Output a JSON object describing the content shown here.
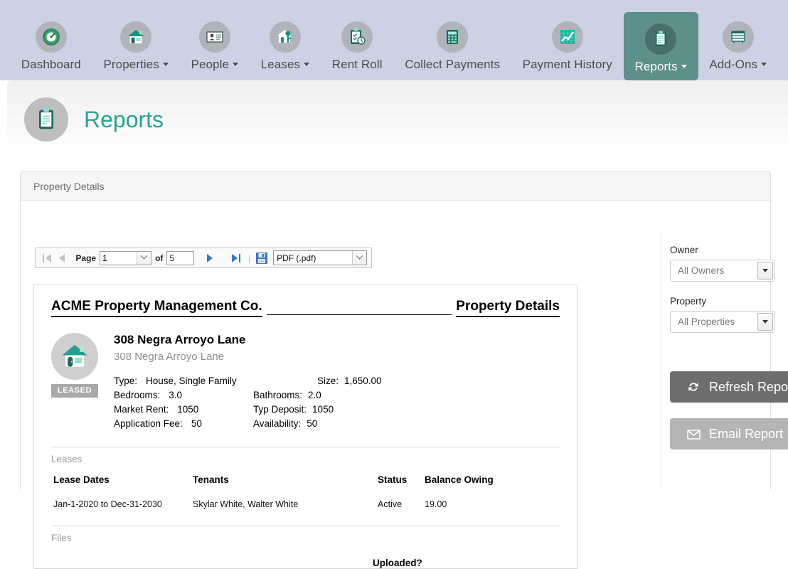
{
  "nav": {
    "items": [
      {
        "label": "Dashboard",
        "icon": "gauge-icon",
        "has_caret": false,
        "active": false
      },
      {
        "label": "Properties",
        "icon": "house-icon",
        "has_caret": true,
        "active": false
      },
      {
        "label": "People",
        "icon": "id-card-icon",
        "has_caret": true,
        "active": false
      },
      {
        "label": "Leases",
        "icon": "house-key-icon",
        "has_caret": true,
        "active": false
      },
      {
        "label": "Rent Roll",
        "icon": "clipboard-clock-icon",
        "has_caret": false,
        "active": false
      },
      {
        "label": "Collect Payments",
        "icon": "calculator-icon",
        "has_caret": false,
        "active": false
      },
      {
        "label": "Payment History",
        "icon": "line-chart-icon",
        "has_caret": false,
        "active": false
      },
      {
        "label": "Reports",
        "icon": "clipboard-icon",
        "has_caret": true,
        "active": true
      },
      {
        "label": "Add-Ons",
        "icon": "drawers-icon",
        "has_caret": true,
        "active": false
      }
    ]
  },
  "page": {
    "title": "Reports",
    "icon": "clipboard-icon"
  },
  "panel": {
    "title": "Property Details"
  },
  "viewer_toolbar": {
    "first_page_label": "first-page",
    "prev_page_label": "previous-page",
    "page_label": "Page",
    "page_value": "1",
    "of_label": "of",
    "total_pages": "5",
    "next_page_label": "next-page",
    "last_page_label": "last-page",
    "save_label": "save",
    "export_format": "PDF (.pdf)"
  },
  "report": {
    "company": "ACME Property Management Co.",
    "report_name": "Property Details",
    "property": {
      "name": "308 Negra Arroyo Lane",
      "address": "308 Negra Arroyo Lane",
      "badge": "LEASED",
      "fields": [
        {
          "k1": "Type:",
          "v1": "House, Single Family",
          "k2": "Size:",
          "v2": "1,650.00"
        },
        {
          "k1": "Bedrooms:",
          "v1": "3.0",
          "k2": "Bathrooms:",
          "v2": "2.0"
        },
        {
          "k1": "Market Rent:",
          "v1": "1050",
          "k2": "Typ Deposit:",
          "v2": "1050"
        },
        {
          "k1": "Application Fee:",
          "v1": "50",
          "k2": "Availability:",
          "v2": "50"
        }
      ]
    },
    "leases": {
      "section_label": "Leases",
      "headers": [
        "Lease Dates",
        "Tenants",
        "Status",
        "Balance Owing"
      ],
      "rows": [
        {
          "dates": "Jan-1-2020 to Dec-31-2030",
          "tenants": "Skylar White, Walter White",
          "status": "Active",
          "balance": "19.00"
        }
      ]
    },
    "files": {
      "section_label": "Files",
      "header_partial": "Uploaded?"
    }
  },
  "sidebar": {
    "owner_label": "Owner",
    "owner_value": "All Owners",
    "property_label": "Property",
    "property_value": "All Properties",
    "refresh_label": "Refresh Report",
    "email_label": "Email Report"
  },
  "colors": {
    "nav_background": "#ccd2e3",
    "accent_teal": "#2aa393",
    "active_tab": "#5d9089",
    "icon_circle": "#b0b3b8",
    "refresh_button": "#6e6e6e",
    "email_button": "#b4b4b4",
    "badge_gray": "#a9a9a9"
  }
}
